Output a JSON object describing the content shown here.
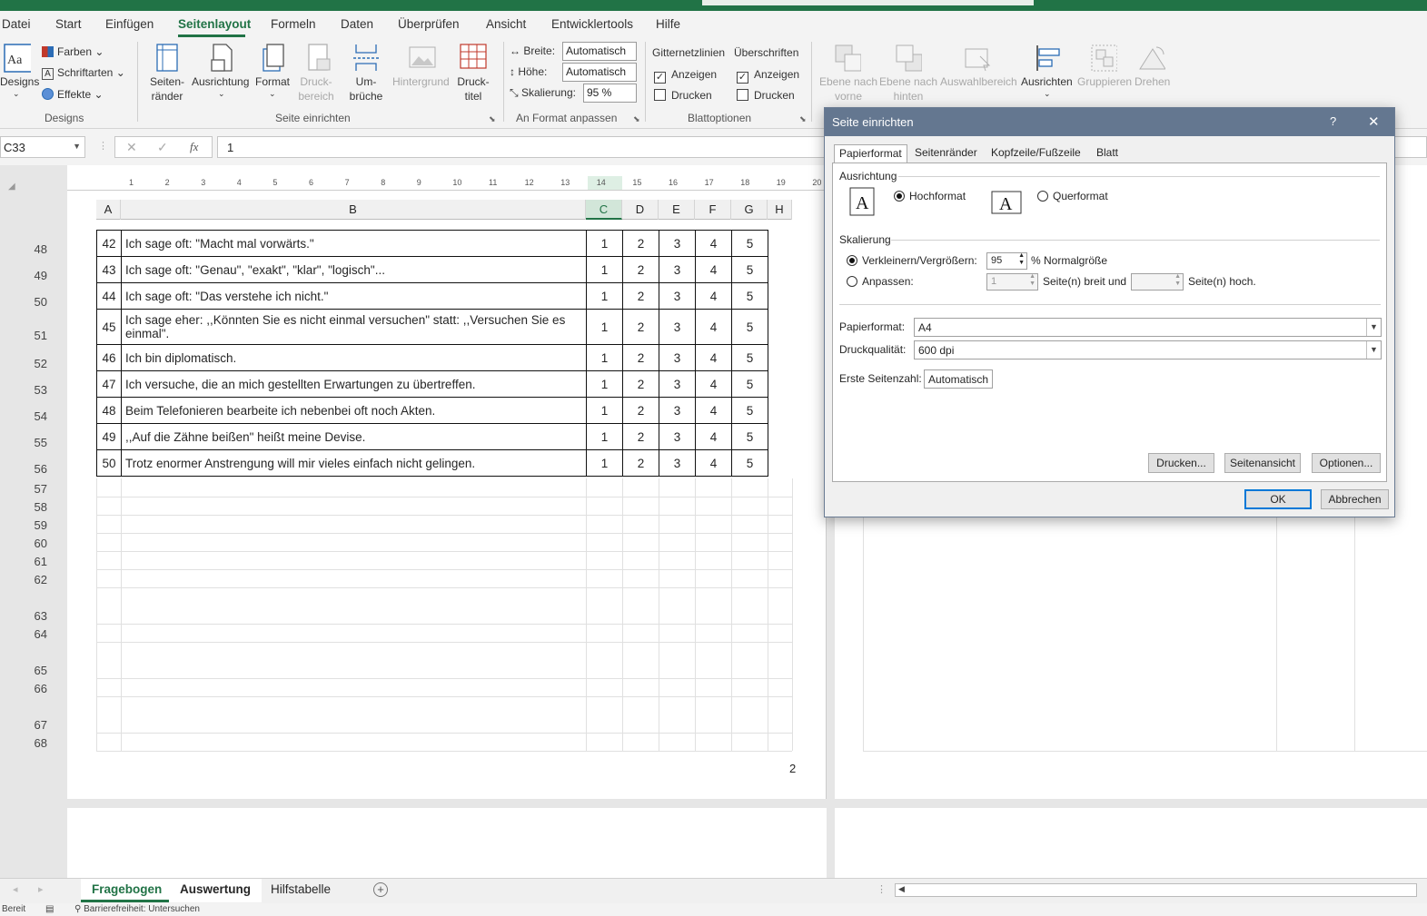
{
  "menu": {
    "tabs": [
      "Datei",
      "Start",
      "Einfügen",
      "Seitenlayout",
      "Formeln",
      "Daten",
      "Überprüfen",
      "Ansicht",
      "Entwicklertools",
      "Hilfe"
    ],
    "active": "Seitenlayout"
  },
  "ribbon": {
    "designs": {
      "big": "Designs",
      "farben": "Farben",
      "schriftarten": "Schriftarten",
      "effekte": "Effekte",
      "group": "Designs"
    },
    "seite": {
      "raender": "Seiten-\nränder",
      "ausrichtung": "Ausrichtung",
      "format": "Format",
      "druckbereich": "Druck-\nbereich",
      "umbrueche": "Um-\nbrüche",
      "hintergrund": "Hintergrund",
      "drucktitel": "Druck-\ntitel",
      "group": "Seite einrichten"
    },
    "anpassen": {
      "breite_label": "Breite:",
      "breite_value": "Automatisch",
      "hoehe_label": "Höhe:",
      "hoehe_value": "Automatisch",
      "skalierung_label": "Skalierung:",
      "skalierung_value": "95 %",
      "group": "An Format anpassen"
    },
    "blatt": {
      "gitter": "Gitternetzlinien",
      "ueberschriften": "Überschriften",
      "anzeigen": "Anzeigen",
      "drucken": "Drucken",
      "group": "Blattoptionen"
    },
    "anordnen": {
      "ebene_vorne": "Ebene nach\nvorne",
      "ebene_hinten": "Ebene nach\nhinten",
      "auswahl": "Auswahlbereich",
      "ausrichten": "Ausrichten",
      "gruppieren": "Gruppieren",
      "drehen": "Drehen"
    }
  },
  "formula": {
    "namebox": "C33",
    "value": "1",
    "fx": "fx"
  },
  "ruler": [
    "1",
    "2",
    "3",
    "4",
    "5",
    "6",
    "7",
    "8",
    "9",
    "10",
    "11",
    "12",
    "13",
    "14",
    "15",
    "16",
    "17",
    "18",
    "19",
    "20"
  ],
  "columns": [
    "A",
    "B",
    "C",
    "D",
    "E",
    "F",
    "G",
    "H"
  ],
  "rows": [
    {
      "num": "48",
      "id": "42",
      "text": "Ich sage oft: \"Macht mal vorwärts.\""
    },
    {
      "num": "49",
      "id": "43",
      "text": "Ich sage oft: \"Genau\", \"exakt\", \"klar\", \"logisch\"..."
    },
    {
      "num": "50",
      "id": "44",
      "text": "Ich sage oft: \"Das verstehe ich nicht.\""
    },
    {
      "num": "51",
      "id": "45",
      "text": "Ich sage eher: ,,Könnten Sie es nicht einmal versuchen\" statt: ,,Versuchen Sie es einmal\"."
    },
    {
      "num": "52",
      "id": "46",
      "text": "Ich bin diplomatisch."
    },
    {
      "num": "53",
      "id": "47",
      "text": "Ich versuche, die an mich gestellten Erwartungen zu übertreffen."
    },
    {
      "num": "54",
      "id": "48",
      "text": "Beim Telefonieren bearbeite ich nebenbei oft noch Akten."
    },
    {
      "num": "55",
      "id": "49",
      "text": ",,Auf die Zähne beißen\" heißt meine Devise."
    },
    {
      "num": "56",
      "id": "50",
      "text": "Trotz enormer Anstrengung will mir vieles einfach nicht gelingen."
    }
  ],
  "scale": [
    "1",
    "2",
    "3",
    "4",
    "5"
  ],
  "empty_rows": [
    "57",
    "58",
    "59",
    "60",
    "61",
    "62",
    "63",
    "64",
    "65",
    "66",
    "67",
    "68"
  ],
  "page_number": "2",
  "dialog": {
    "title": "Seite einrichten",
    "help": "?",
    "close": "✕",
    "tabs": [
      "Papierformat",
      "Seitenränder",
      "Kopfzeile/Fußzeile",
      "Blatt"
    ],
    "ausrichtung": "Ausrichtung",
    "hochformat": "Hochformat",
    "querformat": "Querformat",
    "skalierung": "Skalierung",
    "verkleinern": "Verkleinern/Vergrößern:",
    "verkleinern_value": "95",
    "normalgroesse": "% Normalgröße",
    "anpassen": "Anpassen:",
    "breit_value": "1",
    "breit_label": "Seite(n) breit und",
    "hoch_value": "",
    "hoch_label": "Seite(n) hoch.",
    "papierformat_label": "Papierformat:",
    "papierformat_value": "A4",
    "druckqualitaet_label": "Druckqualität:",
    "druckqualitaet_value": "600 dpi",
    "erste_seite_label": "Erste Seitenzahl:",
    "erste_seite_value": "Automatisch",
    "btn_drucken": "Drucken...",
    "btn_seitenansicht": "Seitenansicht",
    "btn_optionen": "Optionen...",
    "btn_ok": "OK",
    "btn_abbrechen": "Abbrechen"
  },
  "sheets": [
    "Fragebogen",
    "Auswertung",
    "Hilfstabelle"
  ],
  "status": {
    "ready": "Bereit",
    "accessibility": "Barrierefreiheit: Untersuchen"
  },
  "colors": {
    "excel_green": "#217346",
    "dialog_title": "#647790"
  }
}
